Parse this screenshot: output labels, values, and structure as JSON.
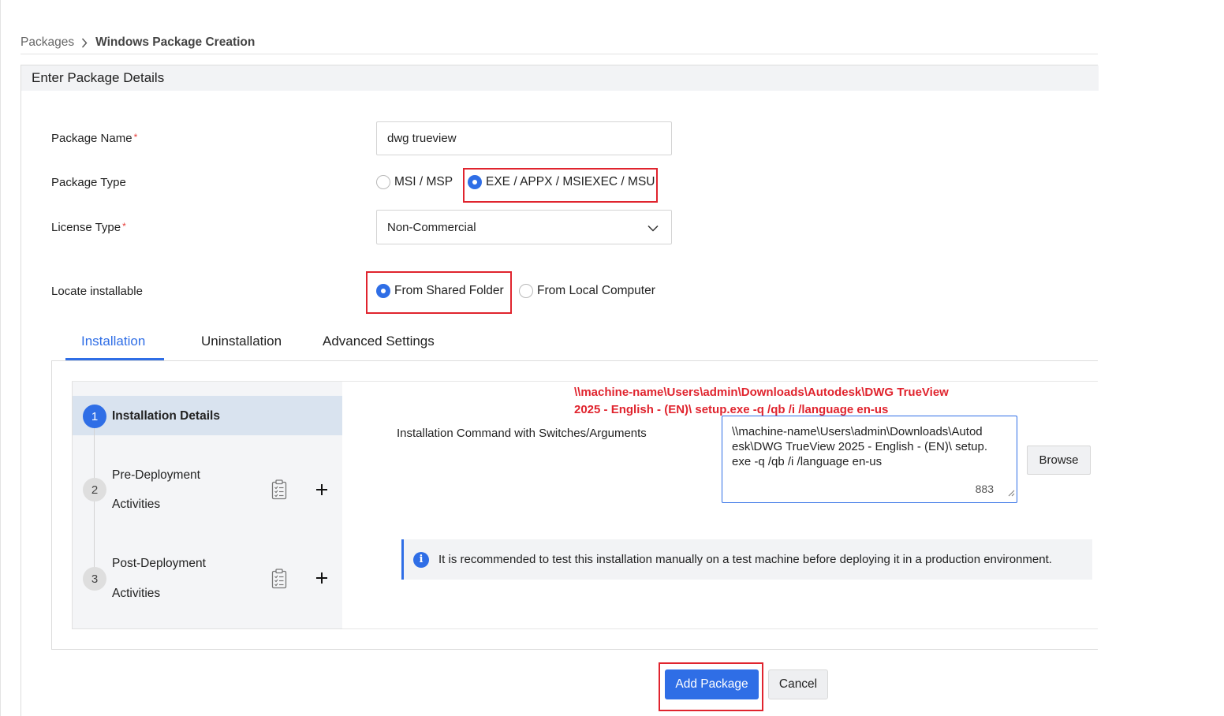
{
  "breadcrumb": {
    "parent": "Packages",
    "current": "Windows Package Creation"
  },
  "panel": {
    "title": "Enter Package Details"
  },
  "form": {
    "package_name": {
      "label": "Package Name",
      "required_mark": "*",
      "value": "dwg trueview"
    },
    "package_type": {
      "label": "Package Type",
      "options": [
        {
          "label": "MSI / MSP",
          "selected": false
        },
        {
          "label": "EXE / APPX / MSIEXEC / MSU",
          "selected": true
        }
      ]
    },
    "license_type": {
      "label": "License Type",
      "required_mark": "*",
      "value": "Non-Commercial"
    },
    "locate_installable": {
      "label": "Locate installable",
      "options": [
        {
          "label": "From Shared Folder",
          "selected": true
        },
        {
          "label": "From Local Computer",
          "selected": false
        }
      ]
    }
  },
  "tabs": [
    {
      "label": "Installation",
      "active": true
    },
    {
      "label": "Uninstallation",
      "active": false
    },
    {
      "label": "Advanced Settings",
      "active": false
    }
  ],
  "steps": [
    {
      "number": "1",
      "title": "Installation Details",
      "active": true
    },
    {
      "number": "2",
      "title_line1": "Pre-Deployment",
      "title_line2": "Activities",
      "active": false
    },
    {
      "number": "3",
      "title_line1": "Post-Deployment",
      "title_line2": "Activities",
      "active": false
    }
  ],
  "annotation": {
    "line1": "\\\\machine-name\\Users\\admin\\Downloads\\Autodesk\\DWG TrueView",
    "line2": "2025 - English - (EN)\\ setup.exe -q /qb /i /language en-us",
    "color": "#e0242e"
  },
  "installation": {
    "command_label": "Installation Command with Switches/Arguments",
    "command_value": "\\\\machine-name\\Users\\admin\\Downloads\\Autodesk\\DWG TrueView 2025 - English - (EN)\\ setup.exe -q /qb /i /language en-us",
    "char_count": "883",
    "browse_label": "Browse"
  },
  "info_message": "It is recommended to test this installation manually on a test machine before deploying it in a production environment.",
  "actions": {
    "add_label": "Add Package",
    "cancel_label": "Cancel"
  },
  "colors": {
    "accent": "#2f6ee6",
    "highlight": "#e0242e"
  }
}
